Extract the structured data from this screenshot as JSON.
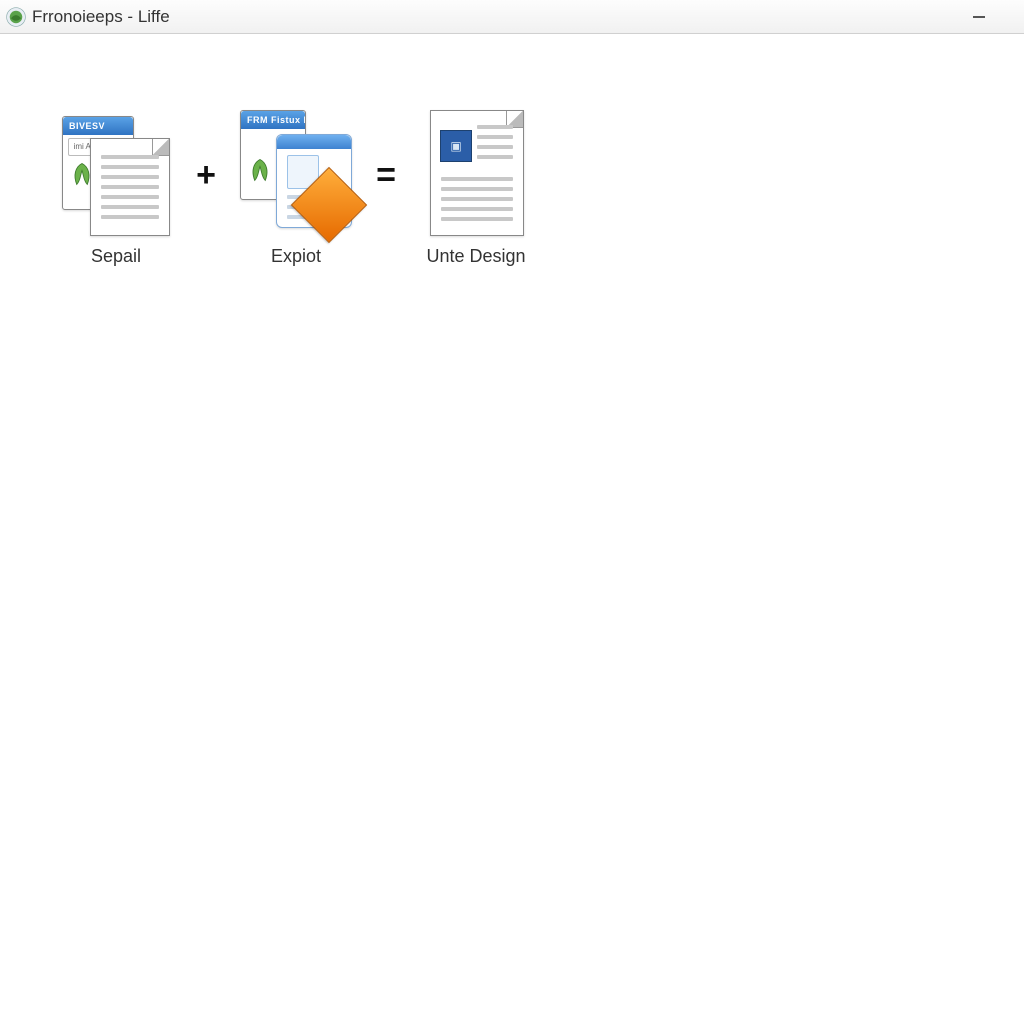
{
  "window": {
    "title": "Frronoieeps - Liffe"
  },
  "tiles": [
    {
      "label": "Sepail",
      "header_text": "BIVESV",
      "badge_text": "imi ASal"
    },
    {
      "label": "Expiot",
      "header_text": "FRM   Fistux I.le"
    },
    {
      "label": "Unte Design"
    }
  ],
  "operators": {
    "plus": "+",
    "equals": "="
  }
}
